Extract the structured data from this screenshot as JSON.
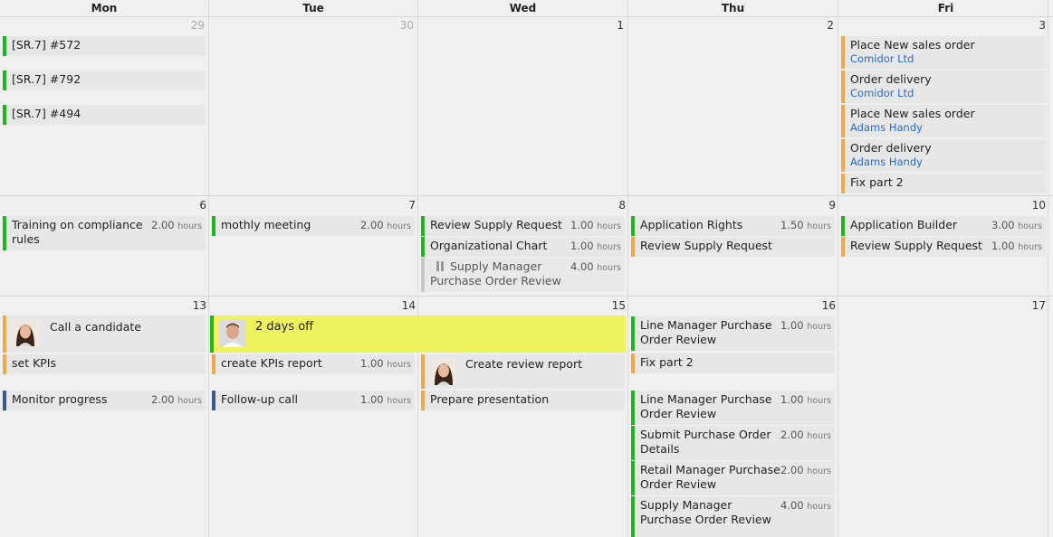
{
  "header": {
    "days": [
      "Mon",
      "Tue",
      "Wed",
      "Thu",
      "Fri"
    ]
  },
  "weeks": [
    {
      "days": [
        "29",
        "30",
        "1",
        "2",
        "3"
      ]
    },
    {
      "days": [
        "6",
        "7",
        "8",
        "9",
        "10"
      ]
    },
    {
      "days": [
        "13",
        "14",
        "15",
        "16",
        "17"
      ]
    }
  ],
  "hours_unit": "hours",
  "events": {
    "w1_mon": [
      "[SR.7] #572",
      "[SR.7] #792",
      "[SR.7] #494"
    ],
    "w1_fri": [
      {
        "title": "Place New sales order",
        "sub": "Comidor Ltd"
      },
      {
        "title": "Order delivery",
        "sub": "Comidor Ltd"
      },
      {
        "title": "Place New sales order",
        "sub": "Adams Handy"
      },
      {
        "title": "Order delivery",
        "sub": "Adams Handy"
      },
      {
        "title": "Fix part 2"
      }
    ],
    "w2_mon": [
      {
        "title": "Training on compliance rules",
        "hours": "2.00"
      }
    ],
    "w2_tue": [
      {
        "title": "mothly meeting",
        "hours": "2.00"
      }
    ],
    "w2_wed": [
      {
        "title": "Review Supply Request",
        "hours": "1.00"
      },
      {
        "title": "Organizational Chart",
        "hours": "1.00"
      },
      {
        "title": "Supply Manager Purchase Order Review",
        "hours": "4.00"
      }
    ],
    "w2_thu": [
      {
        "title": "Application Rights",
        "hours": "1.50"
      },
      {
        "title": "Review Supply Request"
      }
    ],
    "w2_fri": [
      {
        "title": "Application Builder",
        "hours": "3.00"
      },
      {
        "title": "Review Supply Request",
        "hours": "1.00"
      }
    ],
    "w3_mon": [
      {
        "title": "Call a candidate"
      },
      {
        "title": "set KPIs"
      },
      {
        "title": "Monitor progress",
        "hours": "2.00"
      }
    ],
    "w3_dayoff": {
      "title": "2 days off"
    },
    "w3_tue": [
      {
        "title": "create KPIs report",
        "hours": "1.00"
      },
      {
        "title": "Follow-up call",
        "hours": "1.00"
      }
    ],
    "w3_wed": [
      {
        "title": "Create review report"
      },
      {
        "title": "Prepare presentation"
      }
    ],
    "w3_thu": [
      {
        "title": "Line Manager Purchase Order Review",
        "hours": "1.00"
      },
      {
        "title": "Fix part 2"
      },
      {
        "title": "Line Manager Purchase Order Review",
        "hours": "1.00"
      },
      {
        "title": "Submit Purchase Order Details",
        "hours": "2.00"
      },
      {
        "title": "Retail Manager Purchase Order Review",
        "hours": "2.00"
      },
      {
        "title": "Supply Manager Purchase Order Review",
        "hours": "4.00"
      }
    ]
  },
  "colors": {
    "green": "#1fb51f",
    "orange": "#f0a94a",
    "blue": "#3a5a8a",
    "dayoff": "#eef25c",
    "link": "#2a6bc7"
  }
}
